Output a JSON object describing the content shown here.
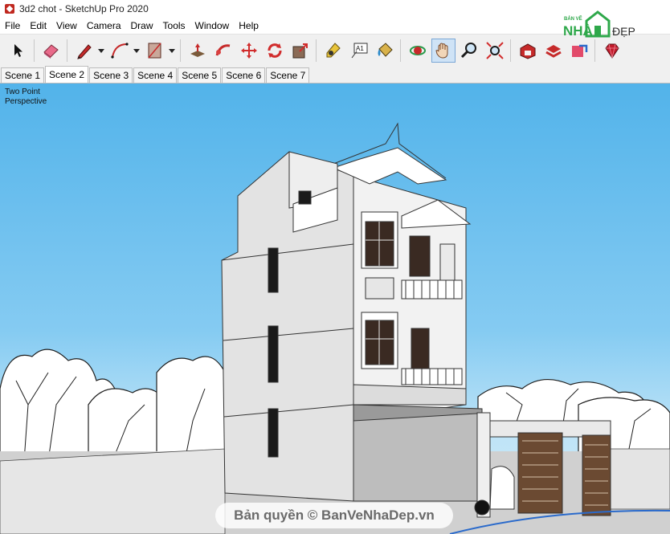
{
  "window": {
    "title": "3d2 chot - SketchUp Pro 2020"
  },
  "menu": [
    "File",
    "Edit",
    "View",
    "Camera",
    "Draw",
    "Tools",
    "Window",
    "Help"
  ],
  "toolbar": {
    "tools": [
      {
        "name": "select-icon"
      },
      {
        "name": "eraser-icon"
      },
      {
        "name": "pencil-icon"
      },
      {
        "name": "arc-icon"
      },
      {
        "name": "rectangle-icon"
      },
      {
        "name": "push-pull-icon"
      },
      {
        "name": "follow-me-icon"
      },
      {
        "name": "move-icon"
      },
      {
        "name": "rotate-icon"
      },
      {
        "name": "scale-icon"
      },
      {
        "name": "tape-measure-icon"
      },
      {
        "name": "text-icon"
      },
      {
        "name": "paint-bucket-icon"
      },
      {
        "name": "orbit-icon"
      },
      {
        "name": "pan-icon"
      },
      {
        "name": "zoom-icon"
      },
      {
        "name": "zoom-extents-icon"
      },
      {
        "name": "warehouse-icon"
      },
      {
        "name": "extension-warehouse-icon"
      },
      {
        "name": "send-to-layout-icon"
      },
      {
        "name": "ruby-console-icon"
      }
    ],
    "text_tool_label": "A1"
  },
  "scenes": {
    "tabs": [
      "Scene 1",
      "Scene 2",
      "Scene 3",
      "Scene 4",
      "Scene 5",
      "Scene 6",
      "Scene 7"
    ],
    "active_index": 1
  },
  "viewport": {
    "camera_label_line1": "Two Point",
    "camera_label_line2": "Perspective",
    "sky_color": "#5db8ec"
  },
  "watermark": {
    "logo_top": "BẢN VẼ",
    "logo_main": "NHÀ",
    "logo_side": "ĐẸP",
    "copyright_text": "Bản quyền © BanVeNhaDep.vn"
  }
}
